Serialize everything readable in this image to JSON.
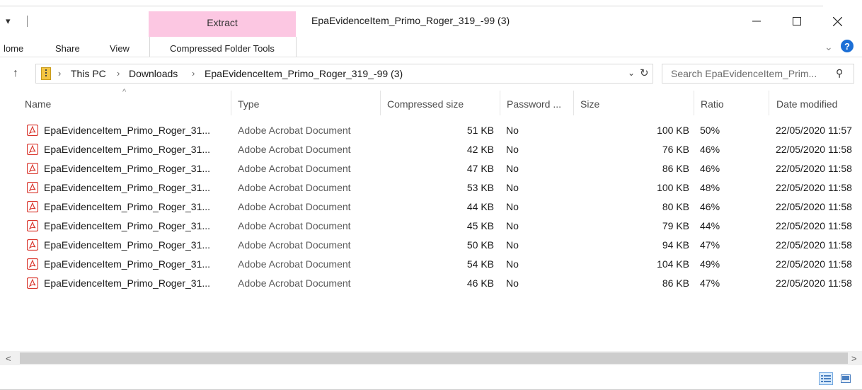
{
  "titlebar": {
    "extract_tab": "Extract",
    "window_title": "EpaEvidenceItem_Primo_Roger_319_-99 (3)",
    "quick_access_arrow": "▾"
  },
  "ribbon": {
    "tabs": [
      "lome",
      "Share",
      "View"
    ],
    "context_tab": "Compressed Folder Tools"
  },
  "address": {
    "crumbs": [
      "This PC",
      "Downloads",
      "EpaEvidenceItem_Primo_Roger_319_-99 (3)"
    ],
    "search_placeholder": "Search EpaEvidenceItem_Prim..."
  },
  "columns": {
    "name": "Name",
    "type": "Type",
    "compressed_size": "Compressed size",
    "password": "Password ...",
    "size": "Size",
    "ratio": "Ratio",
    "date_modified": "Date modified"
  },
  "rows": [
    {
      "name": "EpaEvidenceItem_Primo_Roger_31...",
      "type": "Adobe Acrobat Document",
      "compressed": "51 KB",
      "password": "No",
      "size": "100 KB",
      "ratio": "50%",
      "date": "22/05/2020 11:57"
    },
    {
      "name": "EpaEvidenceItem_Primo_Roger_31...",
      "type": "Adobe Acrobat Document",
      "compressed": "42 KB",
      "password": "No",
      "size": "76 KB",
      "ratio": "46%",
      "date": "22/05/2020 11:58"
    },
    {
      "name": "EpaEvidenceItem_Primo_Roger_31...",
      "type": "Adobe Acrobat Document",
      "compressed": "47 KB",
      "password": "No",
      "size": "86 KB",
      "ratio": "46%",
      "date": "22/05/2020 11:58"
    },
    {
      "name": "EpaEvidenceItem_Primo_Roger_31...",
      "type": "Adobe Acrobat Document",
      "compressed": "53 KB",
      "password": "No",
      "size": "100 KB",
      "ratio": "48%",
      "date": "22/05/2020 11:58"
    },
    {
      "name": "EpaEvidenceItem_Primo_Roger_31...",
      "type": "Adobe Acrobat Document",
      "compressed": "44 KB",
      "password": "No",
      "size": "80 KB",
      "ratio": "46%",
      "date": "22/05/2020 11:58"
    },
    {
      "name": "EpaEvidenceItem_Primo_Roger_31...",
      "type": "Adobe Acrobat Document",
      "compressed": "45 KB",
      "password": "No",
      "size": "79 KB",
      "ratio": "44%",
      "date": "22/05/2020 11:58"
    },
    {
      "name": "EpaEvidenceItem_Primo_Roger_31...",
      "type": "Adobe Acrobat Document",
      "compressed": "50 KB",
      "password": "No",
      "size": "94 KB",
      "ratio": "47%",
      "date": "22/05/2020 11:58"
    },
    {
      "name": "EpaEvidenceItem_Primo_Roger_31...",
      "type": "Adobe Acrobat Document",
      "compressed": "54 KB",
      "password": "No",
      "size": "104 KB",
      "ratio": "49%",
      "date": "22/05/2020 11:58"
    },
    {
      "name": "EpaEvidenceItem_Primo_Roger_31...",
      "type": "Adobe Acrobat Document",
      "compressed": "46 KB",
      "password": "No",
      "size": "86 KB",
      "ratio": "47%",
      "date": "22/05/2020 11:58"
    }
  ],
  "icons": {
    "file": "pdf-file-icon",
    "zip": "zip-folder-icon"
  },
  "colors": {
    "extract_tab_bg": "#fcc7e2",
    "help_blue": "#1c6fd6",
    "pdf_red": "#d9342b"
  }
}
